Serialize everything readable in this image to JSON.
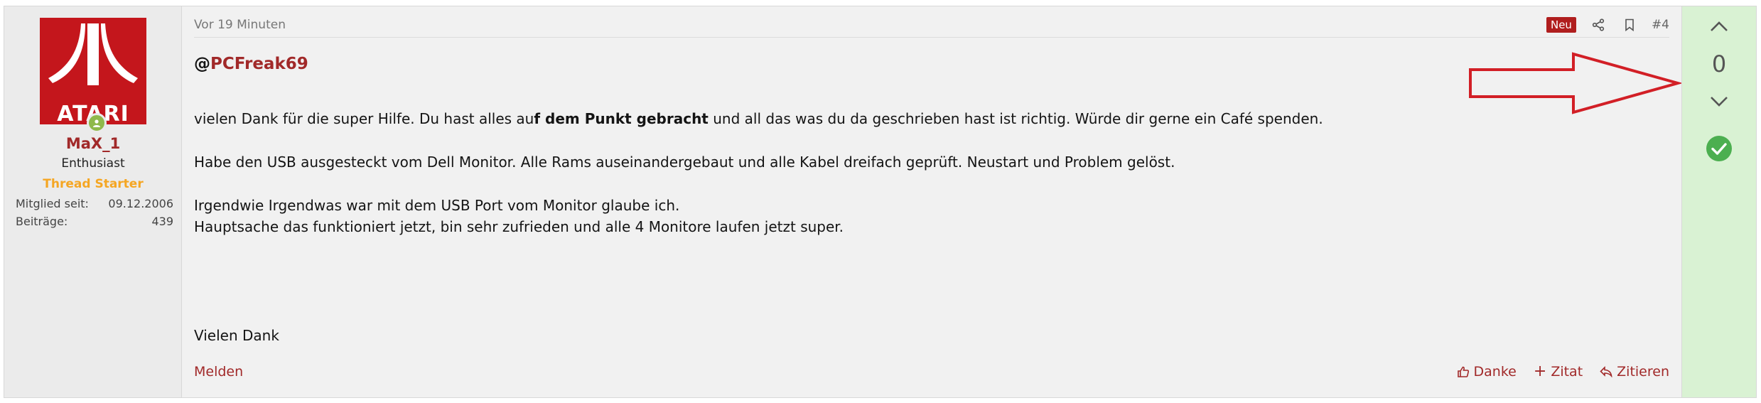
{
  "user": {
    "avatar_text": "ATARI",
    "name": "MaX_1",
    "title": "Enthusiast",
    "banner": "Thread Starter",
    "stats": [
      {
        "label": "Mitglied seit:",
        "value": "09.12.2006"
      },
      {
        "label": "Beiträge:",
        "value": "439"
      }
    ]
  },
  "header": {
    "time": "Vor 19 Minuten",
    "badge": "Neu",
    "post_number": "#4",
    "icons": [
      "share-icon",
      "bookmark-icon"
    ]
  },
  "message": {
    "mention_at": "@",
    "mention_name": "PCFreak69",
    "line1_pre": "vielen Dank für die super Hilfe. Du hast alles au",
    "line1_bold": "f dem Punkt gebracht",
    "line1_post": " und all das was du da geschrieben hast ist richtig. Würde dir gerne ein Café spenden.",
    "line2": "Habe den USB ausgesteckt vom Dell Monitor. Alle Rams auseinandergebaut und alle Kabel dreifach geprüft. Neustart und Problem gelöst.",
    "line3": "Irgendwie Irgendwas war mit dem USB Port vom Monitor glaube ich.",
    "line4": "Hauptsache das funktioniert jetzt, bin sehr zufrieden und alle 4 Monitore laufen jetzt super.",
    "closing": "Vielen Dank"
  },
  "footer": {
    "report": "Melden",
    "like": "Danke",
    "quote": "Zitat",
    "reply": "Zitieren"
  },
  "vote": {
    "count": "0"
  },
  "colors": {
    "accent": "#a12929",
    "badge": "#b01e1e",
    "vote_bg": "#d9f2d3",
    "solution": "#4caf50",
    "annotation": "#d21f26"
  }
}
